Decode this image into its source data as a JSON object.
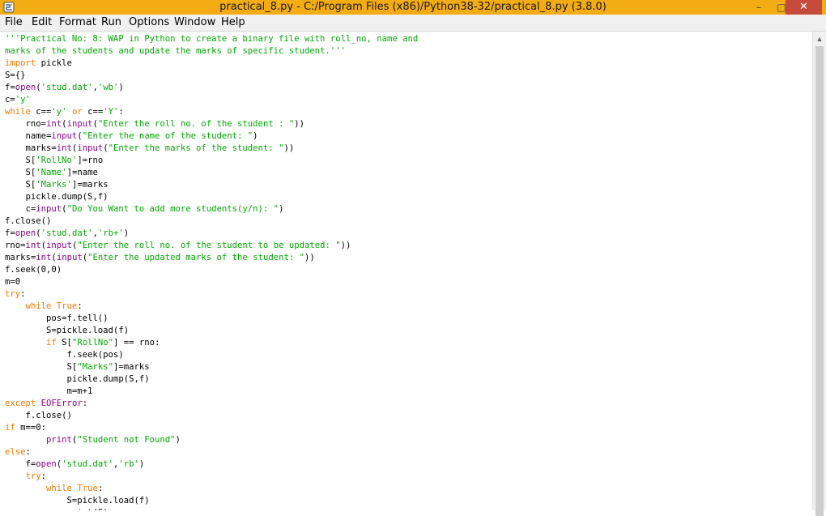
{
  "window": {
    "title": "practical_8.py - C:/Program Files (x86)/Python38-32/practical_8.py (3.8.0)",
    "minimize_glyph": "–",
    "maximize_glyph": "□",
    "close_glyph": "✕"
  },
  "menu": {
    "items": [
      "File",
      "Edit",
      "Format",
      "Run",
      "Options",
      "Window",
      "Help"
    ]
  },
  "scrollbar": {
    "up_glyph": "▲"
  },
  "colors": {
    "titlebar": "#f4ac14",
    "keyword": "#ff7700",
    "string": "#00aa00",
    "builtin": "#900090",
    "close": "#c74b3c"
  },
  "code_lines": [
    [
      [
        "str",
        "'''Practical No: 8: WAP in Python to create a binary file with roll_no, name and"
      ]
    ],
    [
      [
        "str",
        "marks of the students and update the marks of specific student.'''"
      ]
    ],
    [
      [
        "kw",
        "import"
      ],
      [
        "nm",
        " pickle"
      ]
    ],
    [
      [
        "nm",
        "S={}"
      ]
    ],
    [
      [
        "nm",
        "f="
      ],
      [
        "bi",
        "open"
      ],
      [
        "nm",
        "("
      ],
      [
        "str",
        "'stud.dat'"
      ],
      [
        "nm",
        ","
      ],
      [
        "str",
        "'wb'"
      ],
      [
        "nm",
        ")"
      ]
    ],
    [
      [
        "nm",
        "c="
      ],
      [
        "str",
        "'y'"
      ]
    ],
    [
      [
        "kw",
        "while"
      ],
      [
        "nm",
        " c=="
      ],
      [
        "str",
        "'y'"
      ],
      [
        "nm",
        " "
      ],
      [
        "kw",
        "or"
      ],
      [
        "nm",
        " c=="
      ],
      [
        "str",
        "'Y'"
      ],
      [
        "nm",
        ":"
      ]
    ],
    [
      [
        "nm",
        "    rno="
      ],
      [
        "bi",
        "int"
      ],
      [
        "nm",
        "("
      ],
      [
        "bi",
        "input"
      ],
      [
        "nm",
        "("
      ],
      [
        "str",
        "\"Enter the roll no. of the student : \""
      ],
      [
        "nm",
        "))"
      ]
    ],
    [
      [
        "nm",
        "    name="
      ],
      [
        "bi",
        "input"
      ],
      [
        "nm",
        "("
      ],
      [
        "str",
        "\"Enter the name of the student: \""
      ],
      [
        "nm",
        ")"
      ]
    ],
    [
      [
        "nm",
        "    marks="
      ],
      [
        "bi",
        "int"
      ],
      [
        "nm",
        "("
      ],
      [
        "bi",
        "input"
      ],
      [
        "nm",
        "("
      ],
      [
        "str",
        "\"Enter the marks of the student: \""
      ],
      [
        "nm",
        "))"
      ]
    ],
    [
      [
        "nm",
        "    S["
      ],
      [
        "str",
        "'RollNo'"
      ],
      [
        "nm",
        "]=rno"
      ]
    ],
    [
      [
        "nm",
        "    S["
      ],
      [
        "str",
        "'Name'"
      ],
      [
        "nm",
        "]=name"
      ]
    ],
    [
      [
        "nm",
        "    S["
      ],
      [
        "str",
        "'Marks'"
      ],
      [
        "nm",
        "]=marks"
      ]
    ],
    [
      [
        "nm",
        "    pickle.dump(S,f)"
      ]
    ],
    [
      [
        "nm",
        "    c="
      ],
      [
        "bi",
        "input"
      ],
      [
        "nm",
        "("
      ],
      [
        "str",
        "\"Do You Want to add more students(y/n): \""
      ],
      [
        "nm",
        ")"
      ]
    ],
    [
      [
        "nm",
        "f.close()"
      ]
    ],
    [
      [
        "nm",
        "f="
      ],
      [
        "bi",
        "open"
      ],
      [
        "nm",
        "("
      ],
      [
        "str",
        "'stud.dat'"
      ],
      [
        "nm",
        ","
      ],
      [
        "str",
        "'rb+'"
      ],
      [
        "nm",
        ")"
      ]
    ],
    [
      [
        "nm",
        "rno="
      ],
      [
        "bi",
        "int"
      ],
      [
        "nm",
        "("
      ],
      [
        "bi",
        "input"
      ],
      [
        "nm",
        "("
      ],
      [
        "str",
        "\"Enter the roll no. of the student to be updated: \""
      ],
      [
        "nm",
        "))"
      ]
    ],
    [
      [
        "nm",
        "marks="
      ],
      [
        "bi",
        "int"
      ],
      [
        "nm",
        "("
      ],
      [
        "bi",
        "input"
      ],
      [
        "nm",
        "("
      ],
      [
        "str",
        "\"Enter the updated marks of the student: \""
      ],
      [
        "nm",
        "))"
      ]
    ],
    [
      [
        "nm",
        "f.seek(0,0)"
      ]
    ],
    [
      [
        "nm",
        "m=0"
      ]
    ],
    [
      [
        "kw",
        "try"
      ],
      [
        "nm",
        ":"
      ]
    ],
    [
      [
        "nm",
        "    "
      ],
      [
        "kw",
        "while"
      ],
      [
        "nm",
        " "
      ],
      [
        "kw",
        "True"
      ],
      [
        "nm",
        ":"
      ]
    ],
    [
      [
        "nm",
        "        pos=f.tell()"
      ]
    ],
    [
      [
        "nm",
        "        S=pickle.load(f)"
      ]
    ],
    [
      [
        "nm",
        "        "
      ],
      [
        "kw",
        "if"
      ],
      [
        "nm",
        " S["
      ],
      [
        "str",
        "\"RollNo\""
      ],
      [
        "nm",
        "] == rno:"
      ]
    ],
    [
      [
        "nm",
        "            f.seek(pos)"
      ]
    ],
    [
      [
        "nm",
        "            S["
      ],
      [
        "str",
        "\"Marks\""
      ],
      [
        "nm",
        "]=marks"
      ]
    ],
    [
      [
        "nm",
        "            pickle.dump(S,f)"
      ]
    ],
    [
      [
        "nm",
        "            m=m+1"
      ]
    ],
    [
      [
        "kw",
        "except"
      ],
      [
        "nm",
        " "
      ],
      [
        "bi",
        "EOFError"
      ],
      [
        "nm",
        ":"
      ]
    ],
    [
      [
        "nm",
        "    f.close()"
      ]
    ],
    [
      [
        "kw",
        "if"
      ],
      [
        "nm",
        " m==0:"
      ]
    ],
    [
      [
        "nm",
        "        "
      ],
      [
        "bi",
        "print"
      ],
      [
        "nm",
        "("
      ],
      [
        "str",
        "\"Student not Found\""
      ],
      [
        "nm",
        ")"
      ]
    ],
    [
      [
        "kw",
        "else"
      ],
      [
        "nm",
        ":"
      ]
    ],
    [
      [
        "nm",
        "    f="
      ],
      [
        "bi",
        "open"
      ],
      [
        "nm",
        "("
      ],
      [
        "str",
        "'stud.dat'"
      ],
      [
        "nm",
        ","
      ],
      [
        "str",
        "'rb'"
      ],
      [
        "nm",
        ")"
      ]
    ],
    [
      [
        "nm",
        "    "
      ],
      [
        "kw",
        "try"
      ],
      [
        "nm",
        ":"
      ]
    ],
    [
      [
        "nm",
        "        "
      ],
      [
        "kw",
        "while"
      ],
      [
        "nm",
        " "
      ],
      [
        "kw",
        "True"
      ],
      [
        "nm",
        ":"
      ]
    ],
    [
      [
        "nm",
        "            S=pickle.load(f)"
      ]
    ],
    [
      [
        "nm",
        "            "
      ],
      [
        "bi",
        "print"
      ],
      [
        "nm",
        "(S)"
      ]
    ]
  ]
}
